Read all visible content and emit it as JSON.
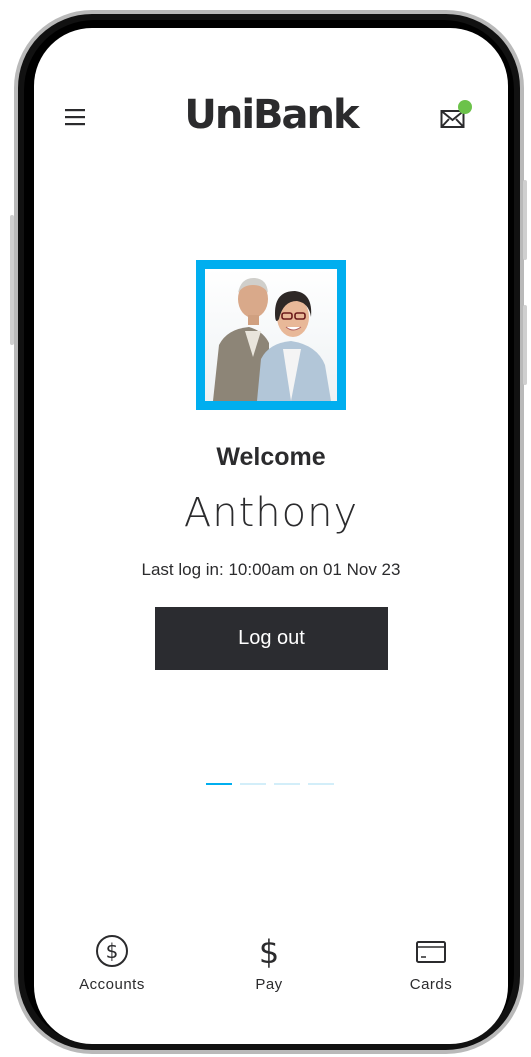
{
  "header": {
    "logo_text": "UniBank",
    "menu_icon": "hamburger-menu-icon",
    "mail_icon": "mail-icon",
    "notification_color": "#6cc24a"
  },
  "profile": {
    "welcome": "Welcome",
    "name": "Anthony",
    "last_login": "Last log in: 10:00am on 01 Nov 23",
    "avatar_border_color": "#00aeef"
  },
  "actions": {
    "logout_label": "Log out"
  },
  "pager": {
    "count": 4,
    "active_index": 0
  },
  "bottom_nav": {
    "items": [
      {
        "label": "Accounts",
        "icon": "dollar-circle-icon"
      },
      {
        "label": "Pay",
        "icon": "dollar-sign-icon"
      },
      {
        "label": "Cards",
        "icon": "credit-card-icon"
      }
    ]
  },
  "colors": {
    "accent": "#00aeef",
    "dark": "#2b2c30",
    "text": "#2b2b2d"
  }
}
